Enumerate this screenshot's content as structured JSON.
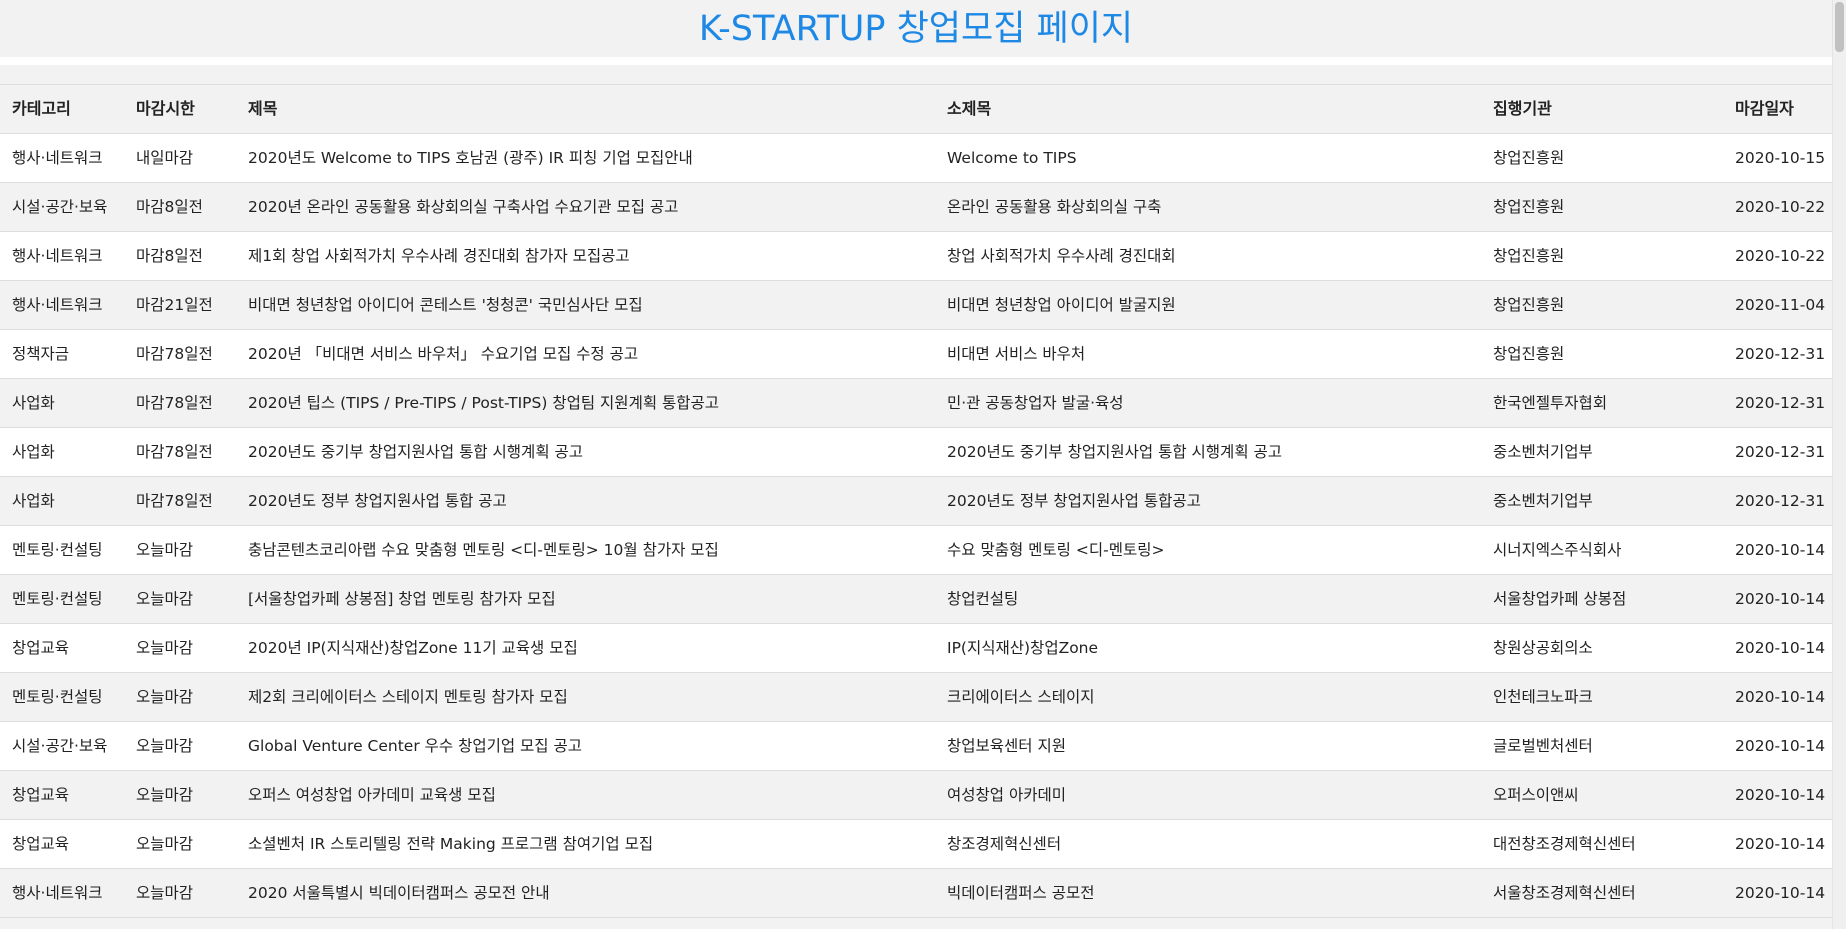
{
  "title": "K-STARTUP 창업모집 페이지",
  "table": {
    "headers": [
      "카테고리",
      "마감시한",
      "제목",
      "소제목",
      "집행기관",
      "마감일자"
    ],
    "rows": [
      [
        "행사·네트워크",
        "내일마감",
        "2020년도 Welcome to TIPS 호남권 (광주) IR 피칭 기업 모집안내",
        "Welcome to TIPS",
        "창업진흥원",
        "2020-10-15"
      ],
      [
        "시설·공간·보육",
        "마감8일전",
        "2020년 온라인 공동활용 화상회의실 구축사업 수요기관 모집 공고",
        "온라인 공동활용 화상회의실 구축",
        "창업진흥원",
        "2020-10-22"
      ],
      [
        "행사·네트워크",
        "마감8일전",
        "제1회 창업 사회적가치 우수사례 경진대회 참가자 모집공고",
        "창업 사회적가치 우수사례 경진대회",
        "창업진흥원",
        "2020-10-22"
      ],
      [
        "행사·네트워크",
        "마감21일전",
        "비대면 청년창업 아이디어 콘테스트 '청청콘' 국민심사단 모집",
        "비대면 청년창업 아이디어 발굴지원",
        "창업진흥원",
        "2020-11-04"
      ],
      [
        "정책자금",
        "마감78일전",
        "2020년 「비대면 서비스 바우처」 수요기업 모집 수정 공고",
        "비대면 서비스 바우처",
        "창업진흥원",
        "2020-12-31"
      ],
      [
        "사업화",
        "마감78일전",
        "2020년 팁스 (TIPS / Pre-TIPS / Post-TIPS) 창업팀 지원계획 통합공고",
        "민·관 공동창업자 발굴·육성",
        "한국엔젤투자협회",
        "2020-12-31"
      ],
      [
        "사업화",
        "마감78일전",
        "2020년도 중기부 창업지원사업 통합 시행계획 공고",
        "2020년도 중기부 창업지원사업 통합 시행계획 공고",
        "중소벤처기업부",
        "2020-12-31"
      ],
      [
        "사업화",
        "마감78일전",
        "2020년도 정부 창업지원사업 통합 공고",
        "2020년도 정부 창업지원사업 통합공고",
        "중소벤처기업부",
        "2020-12-31"
      ],
      [
        "멘토링·컨설팅",
        "오늘마감",
        "충남콘텐츠코리아랩 수요 맞춤형 멘토링 <디-멘토링> 10월 참가자 모집",
        "수요 맞춤형 멘토링 <디-멘토링>",
        "시너지엑스주식회사",
        "2020-10-14"
      ],
      [
        "멘토링·컨설팅",
        "오늘마감",
        "[서울창업카페 상봉점] 창업 멘토링 참가자 모집",
        "창업컨설팅",
        "서울창업카페 상봉점",
        "2020-10-14"
      ],
      [
        "창업교육",
        "오늘마감",
        "2020년 IP(지식재산)창업Zone 11기 교육생 모집",
        "IP(지식재산)창업Zone",
        "창원상공회의소",
        "2020-10-14"
      ],
      [
        "멘토링·컨설팅",
        "오늘마감",
        "제2회 크리에이터스 스테이지 멘토링 참가자 모집",
        "크리에이터스 스테이지",
        "인천테크노파크",
        "2020-10-14"
      ],
      [
        "시설·공간·보육",
        "오늘마감",
        "Global Venture Center 우수 창업기업 모집 공고",
        "창업보육센터 지원",
        "글로벌벤처센터",
        "2020-10-14"
      ],
      [
        "창업교육",
        "오늘마감",
        "오퍼스 여성창업 아카데미 교육생 모집",
        "여성창업 아카데미",
        "오퍼스이앤씨",
        "2020-10-14"
      ],
      [
        "창업교육",
        "오늘마감",
        "소셜벤처 IR 스토리텔링 전략 Making 프로그램 참여기업 모집",
        "창조경제혁신센터",
        "대전창조경제혁신센터",
        "2020-10-14"
      ],
      [
        "행사·네트워크",
        "오늘마감",
        "2020 서울특별시 빅데이터캠퍼스 공모전 안내",
        "빅데이터캠퍼스 공모전",
        "서울창조경제혁신센터",
        "2020-10-14"
      ]
    ]
  }
}
